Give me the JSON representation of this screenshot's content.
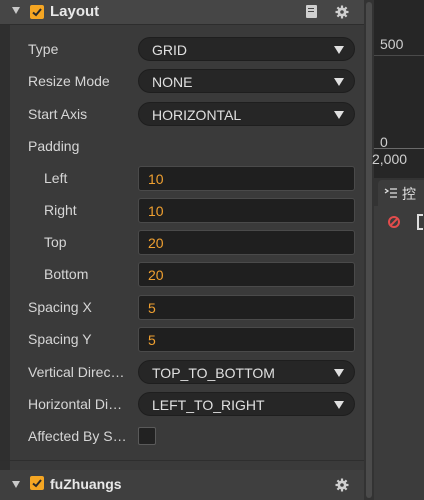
{
  "header": {
    "title": "Layout"
  },
  "rows": {
    "type": {
      "label": "Type",
      "value": "GRID"
    },
    "resize_mode": {
      "label": "Resize Mode",
      "value": "NONE"
    },
    "start_axis": {
      "label": "Start Axis",
      "value": "HORIZONTAL"
    },
    "padding": {
      "label": "Padding"
    },
    "left": {
      "label": "Left",
      "value": "10"
    },
    "right": {
      "label": "Right",
      "value": "10"
    },
    "top": {
      "label": "Top",
      "value": "20"
    },
    "bottom": {
      "label": "Bottom",
      "value": "20"
    },
    "spacing_x": {
      "label": "Spacing X",
      "value": "5"
    },
    "spacing_y": {
      "label": "Spacing Y",
      "value": "5"
    },
    "vertical_direction": {
      "label": "Vertical Direc…",
      "value": "TOP_TO_BOTTOM"
    },
    "horizontal_direction": {
      "label": "Horizontal Di…",
      "value": "LEFT_TO_RIGHT"
    },
    "affected_by_scale": {
      "label": "Affected By S…",
      "checked": false
    }
  },
  "next_component": {
    "title": "fuZhuangs"
  },
  "right_panel": {
    "graph_value_top": "500",
    "graph_value_zero": "0",
    "graph_value_x": "2,000",
    "tab_label": "控"
  },
  "colors": {
    "accent": "#f5a623",
    "value_orange": "#f0a030",
    "error_red": "#e24c4c"
  }
}
